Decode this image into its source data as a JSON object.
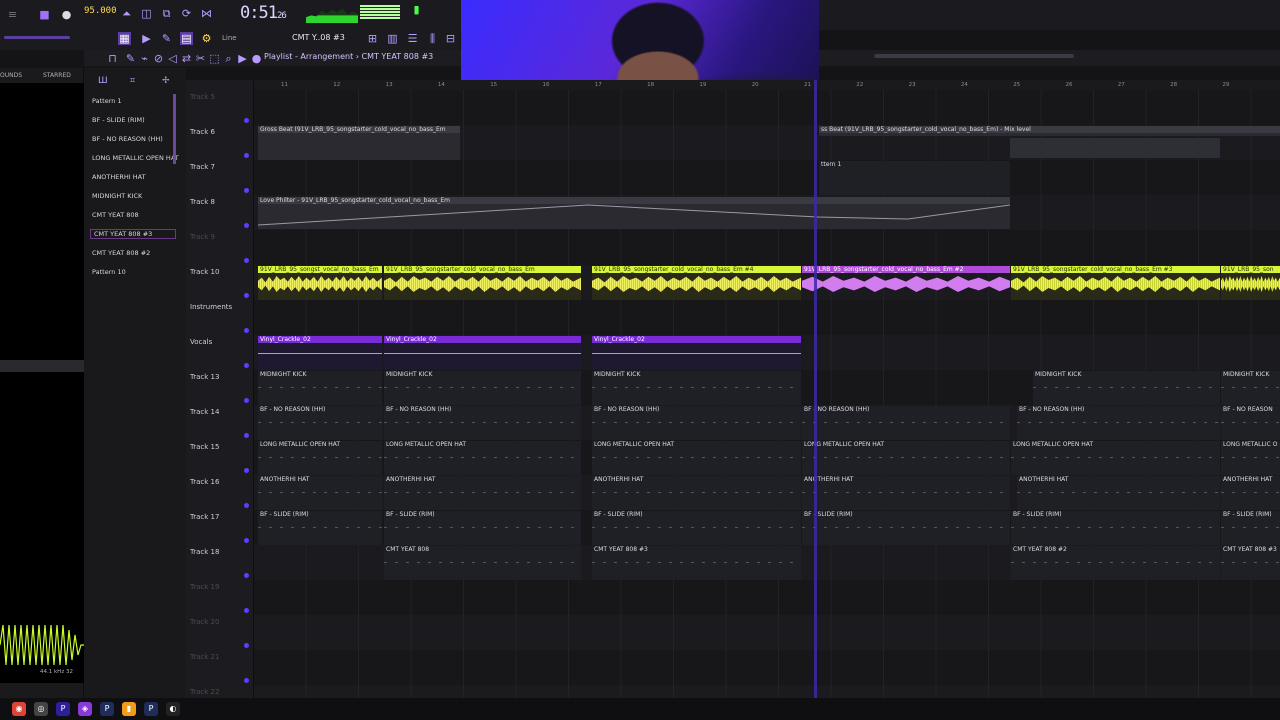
{
  "transport": {
    "tempo": "95.000",
    "time": "0:51",
    "time_frac": "26",
    "pattern_selector": "CMT Y..08 #3",
    "snap": "Line"
  },
  "playlist": {
    "title": "Playlist - Arrangement › CMT YEAT 808 #3"
  },
  "browser": {
    "tabs": [
      "OUNDS",
      "STARRED"
    ],
    "sample_rate": "44.1 kHz 32"
  },
  "picker": {
    "items": [
      {
        "label": "Pattern 1"
      },
      {
        "label": "BF - SLIDE (RIM)"
      },
      {
        "label": "BF - NO REASON (HH)"
      },
      {
        "label": "LONG METALLIC OPEN HAT"
      },
      {
        "label": "ANOTHERHI HAT"
      },
      {
        "label": "MIDNIGHT KICK"
      },
      {
        "label": "CMT YEAT 808"
      },
      {
        "label": "CMT YEAT 808 #3"
      },
      {
        "label": "CMT YEAT 808 #2"
      },
      {
        "label": "Pattern 10"
      }
    ]
  },
  "ruler": {
    "bars": [
      "11",
      "12",
      "13",
      "14",
      "15",
      "16",
      "17",
      "18",
      "19",
      "20",
      "21",
      "22",
      "23",
      "24",
      "25",
      "26",
      "27",
      "28",
      "29"
    ]
  },
  "tracks": [
    {
      "label": "Track 5",
      "dim": true
    },
    {
      "label": "Track 6",
      "dim": false
    },
    {
      "label": "Track 7",
      "dim": false
    },
    {
      "label": "Track 8",
      "dim": false
    },
    {
      "label": "Track 9",
      "dim": true
    },
    {
      "label": "Track 10",
      "dim": false
    },
    {
      "label": "Instruments",
      "dim": false
    },
    {
      "label": "Vocals",
      "dim": false
    },
    {
      "label": "Track 13",
      "dim": false
    },
    {
      "label": "Track 14",
      "dim": false
    },
    {
      "label": "Track 15",
      "dim": false
    },
    {
      "label": "Track 16",
      "dim": false
    },
    {
      "label": "Track 17",
      "dim": false
    },
    {
      "label": "Track 18",
      "dim": false
    },
    {
      "label": "Track 19",
      "dim": true
    },
    {
      "label": "Track 20",
      "dim": true
    },
    {
      "label": "Track 21",
      "dim": true
    },
    {
      "label": "Track 22",
      "dim": true
    }
  ],
  "clips": {
    "gross_beat": "Gross Beat (91V_LRB_95_songstarter_cold_vocal_no_bass_Em",
    "gross_beat_2": "ss Beat (91V_LRB_95_songstarter_cold_vocal_no_bass_Em) - Mix level",
    "pattern_1": "ttern 1",
    "love_philter": "Love Philter - 91V_LRB_95_songstarter_cold_vocal_no_bass_Em",
    "vocal_1": "91V_LRB_95_songst_vocal_no_bass_Em",
    "vocal_2": "91V_LRB_95_songstarter_cold_vocal_no_bass_Em",
    "vocal_3": "91V_LRB_95_songstarter_cold_vocal_no_bass_Em #4",
    "vocal_4": "91V_LRB_95_songstarter_cold_vocal_no_bass_Em #2",
    "vocal_5": "91V_LRB_95_songstarter_cold_vocal_no_bass_Em #3",
    "vocal_6": "91V_LRB_95_son",
    "vinyl": "Vinyl_Crackle_02",
    "midnight": "MIDNIGHT KICK",
    "noreason": "BF - NO REASON (HH)",
    "noreason_cut": "BF - NO REASON",
    "openhat": "LONG METALLIC OPEN HAT",
    "openhat_cut": "LONG METALLIC O",
    "anotherhat": "ANOTHERHI HAT",
    "slide": "BF - SLIDE (RIM)",
    "yeat": "CMT YEAT 808",
    "yeat3": "CMT YEAT 808 #3",
    "yeat2": "CMT YEAT 808 #2"
  },
  "colors": {
    "accent": "#8a5cff",
    "vocal_clip": "#d8f53a",
    "vocal_clip_alt": "#b04ad8",
    "vinyl_clip": "#7a2bd8"
  }
}
